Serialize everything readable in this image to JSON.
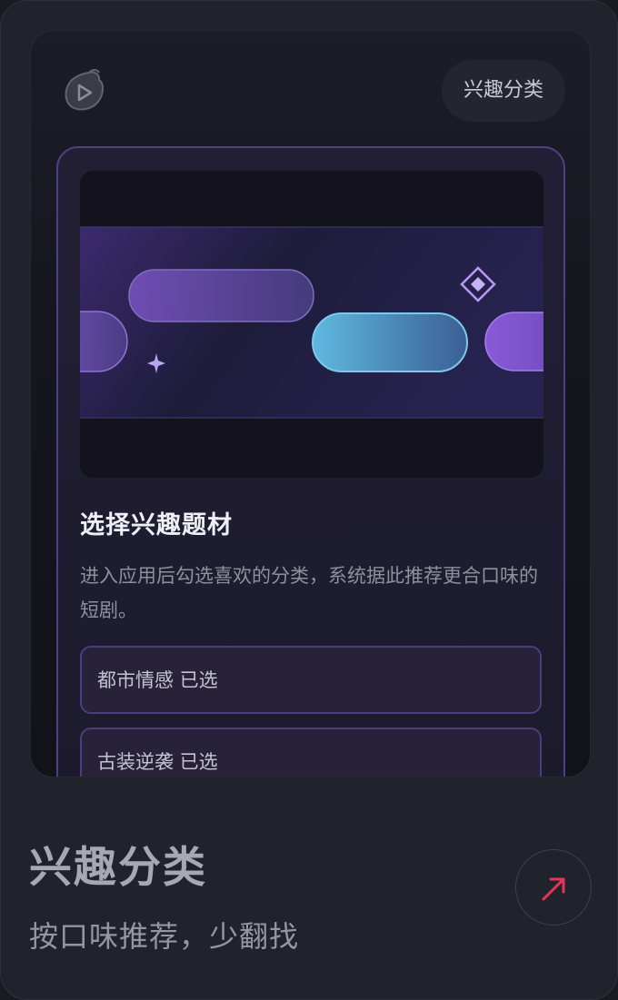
{
  "header": {
    "tag_label": "兴趣分类",
    "logo_icon": "play-mascot-icon"
  },
  "panel": {
    "banner_icons": [
      "sparkle-icon",
      "diamond-icon"
    ],
    "title": "选择兴趣题材",
    "description": "进入应用后勾选喜欢的分类，系统据此推荐更合口味的短剧。",
    "options": [
      {
        "label": "都市情感 已选"
      },
      {
        "label": "古装逆袭 已选"
      }
    ]
  },
  "footer": {
    "title": "兴趣分类",
    "subtitle": "按口味推荐，少翻找",
    "action_icon": "arrow-up-right-icon"
  },
  "colors": {
    "accent_purple": "#4e3f86",
    "accent_cyan": "#5fb8e0",
    "arrow_red": "#e8345a"
  }
}
